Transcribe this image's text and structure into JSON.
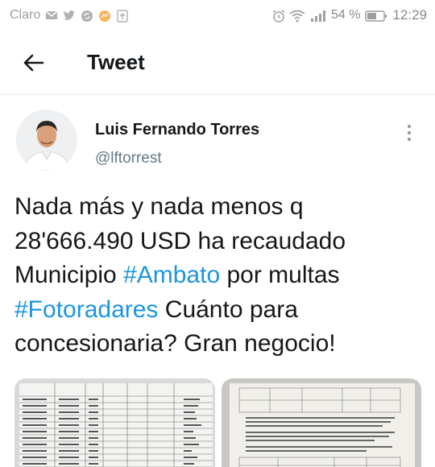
{
  "status_bar": {
    "carrier": "Claro",
    "battery_percent": "54 %",
    "time": "12:29",
    "icons": [
      "mail-icon",
      "twitter-icon",
      "sync-icon",
      "messenger-icon",
      "upload-icon",
      "alarm-icon",
      "wifi-icon",
      "signal-icon",
      "battery-icon"
    ]
  },
  "header": {
    "title": "Tweet",
    "back_icon": "arrow-left-icon"
  },
  "author": {
    "name": "Luis Fernando Torres",
    "handle": "@lftorrest",
    "more_icon": "more-vertical-icon"
  },
  "tweet": {
    "text_1": "Nada más y nada menos q",
    "text_2": "28'666.490 USD ha recaudado",
    "text_3": "Municipio ",
    "hashtag_1": "#Ambato",
    "text_4": " por multas",
    "hashtag_2": "#Fotoradares",
    "text_5": " Cuánto para",
    "text_6": "concesionaria? Gran negocio!"
  },
  "colors": {
    "hashtag": "#1b95e0",
    "handle": "#657786",
    "text": "#14171a"
  }
}
